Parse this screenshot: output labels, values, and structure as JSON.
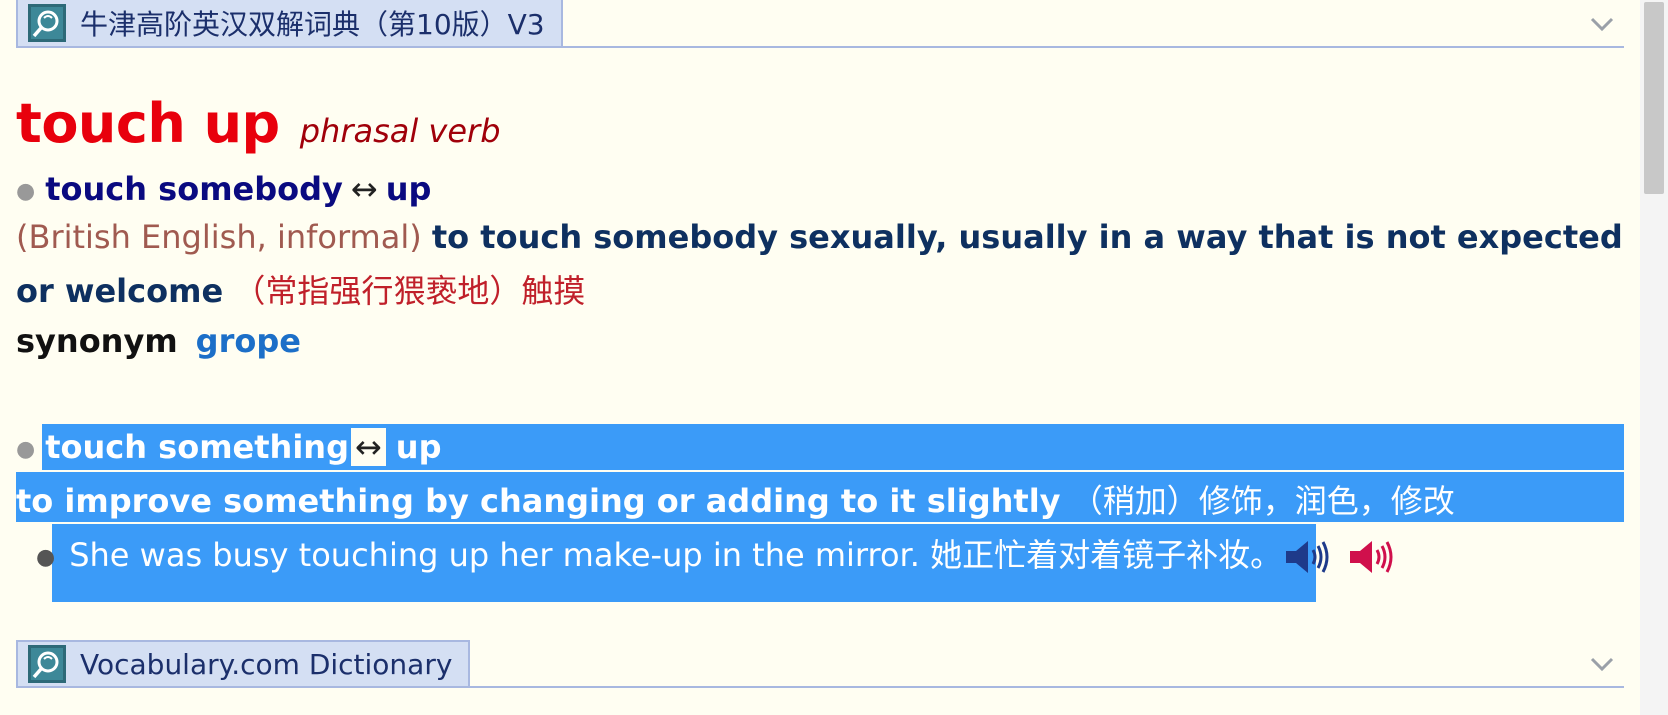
{
  "top_dictionary": {
    "title": "牛津高阶英汉双解词典（第10版）V3",
    "collapse_icon": "chevron-down-icon",
    "logo_icon": "dictionary-logo-icon"
  },
  "entry": {
    "headword": "touch up",
    "part_of_speech": "phrasal verb",
    "senses": [
      {
        "phrase_verb": "touch somebody",
        "arrow": "↔",
        "phrase_particle": "up",
        "register": "(British English, informal)",
        "definition_line1": "to touch somebody sexually, usually in a way that is not expected",
        "definition_line2": "or welcome",
        "definition_cn": "（常指强行猥亵地）触摸",
        "synonym_label": "synonym",
        "synonym_word": "grope"
      },
      {
        "phrase_verb": "touch something",
        "arrow": "↔",
        "phrase_particle": "up",
        "definition": "to improve something by changing or adding to it slightly",
        "definition_cn": "（稍加）修饰，润色，修改",
        "example_en": "She was busy touching up her make-up in the mirror.",
        "example_cn": "她正忙着对着镜子补妆。",
        "audio_uk_icon": "speaker-uk-icon",
        "audio_us_icon": "speaker-us-icon"
      }
    ]
  },
  "bottom_dictionary": {
    "title": "Vocabulary.com Dictionary",
    "collapse_icon": "chevron-down-icon",
    "logo_icon": "dictionary-logo-icon"
  },
  "colors": {
    "background": "#fffef2",
    "headword": "#e8000c",
    "selection": "#3b9bf8",
    "header_tab": "#d4dff3",
    "synonym_link": "#1c6fc8",
    "speaker_uk": "#1e3a8a",
    "speaker_us": "#d0104c"
  }
}
